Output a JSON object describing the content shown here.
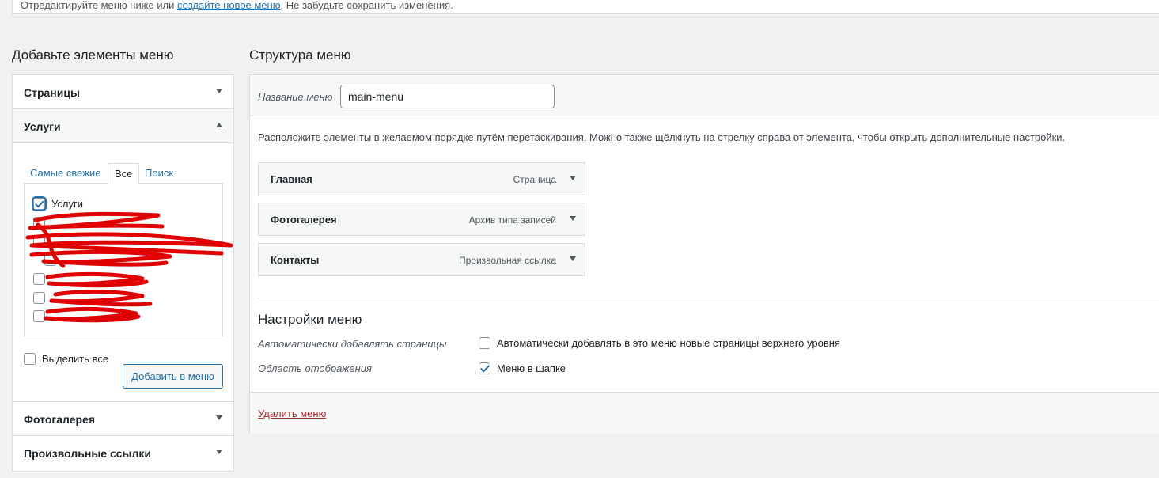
{
  "notice": {
    "text_before": "Отредактируйте меню ниже или ",
    "link": "создайте новое меню",
    "text_after": ". Не забудьте сохранить изменения."
  },
  "left": {
    "title": "Добавьте элементы меню",
    "sections": {
      "pages": "Страницы",
      "services": "Услуги",
      "gallery": "Фотогалерея",
      "custom_links": "Произвольные ссылки"
    },
    "tabs": {
      "recent": "Самые свежие",
      "all": "Все",
      "search": "Поиск"
    },
    "items": [
      "Услуги",
      "",
      "",
      "",
      "",
      "",
      ""
    ],
    "select_all": "Выделить все",
    "add_button": "Добавить в меню"
  },
  "right": {
    "title": "Структура меню",
    "name_label": "Название меню",
    "name_value": "main-menu",
    "instructions": "Расположите элементы в желаемом порядке путём перетаскивания. Можно также щёлкнуть на стрелку справа от элемента, чтобы открыть дополнительные настройки.",
    "menu_items": [
      {
        "title": "Главная",
        "type": "Страница"
      },
      {
        "title": "Фотогалерея",
        "type": "Архив типа записей"
      },
      {
        "title": "Контакты",
        "type": "Произвольная ссылка"
      }
    ],
    "settings": {
      "title": "Настройки меню",
      "auto_label": "Автоматически добавлять страницы",
      "auto_option": "Автоматически добавлять в это меню новые страницы верхнего уровня",
      "auto_checked": false,
      "location_label": "Область отображения",
      "location_option": "Меню в шапке",
      "location_checked": true
    },
    "delete_link": "Удалить меню"
  },
  "colors": {
    "accent": "#2271b1",
    "danger": "#b32d2e",
    "scribble": "#e00000"
  }
}
